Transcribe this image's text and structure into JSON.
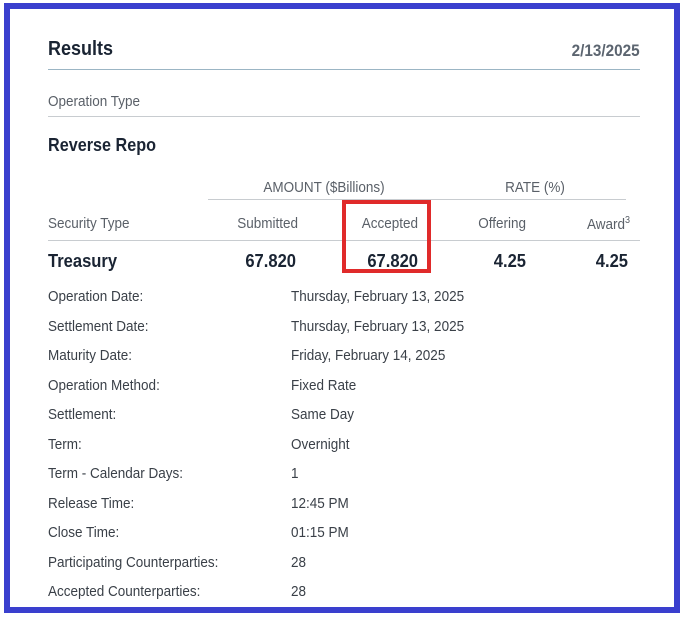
{
  "header": {
    "title": "Results",
    "date": "2/13/2025"
  },
  "operation": {
    "type_label": "Operation Type",
    "type_value": "Reverse Repo"
  },
  "table": {
    "group_amount": "AMOUNT ($Billions)",
    "group_rate": "RATE (%)",
    "columns": {
      "security_type": "Security Type",
      "submitted": "Submitted",
      "accepted": "Accepted",
      "offering": "Offering",
      "award": "Award",
      "award_footnote": "3"
    },
    "row": {
      "security_type": "Treasury",
      "submitted": "67.820",
      "accepted": "67.820",
      "offering": "4.25",
      "award": "4.25"
    }
  },
  "details": [
    {
      "label": "Operation Date:",
      "value": "Thursday, February 13, 2025"
    },
    {
      "label": "Settlement Date:",
      "value": "Thursday, February 13, 2025"
    },
    {
      "label": "Maturity Date:",
      "value": "Friday, February 14, 2025"
    },
    {
      "label": "Operation Method:",
      "value": "Fixed Rate"
    },
    {
      "label": "Settlement:",
      "value": "Same Day"
    },
    {
      "label": "Term:",
      "value": "Overnight"
    },
    {
      "label": "Term - Calendar Days:",
      "value": "1"
    },
    {
      "label": "Release Time:",
      "value": "12:45 PM"
    },
    {
      "label": "Close Time:",
      "value": "01:15 PM"
    },
    {
      "label": "Participating Counterparties:",
      "value": "28"
    },
    {
      "label": "Accepted Counterparties:",
      "value": "28"
    }
  ],
  "colors": {
    "frame_border": "#3a3fce",
    "highlight_box": "#e02a2a",
    "header_rule": "#9bb5c4"
  }
}
